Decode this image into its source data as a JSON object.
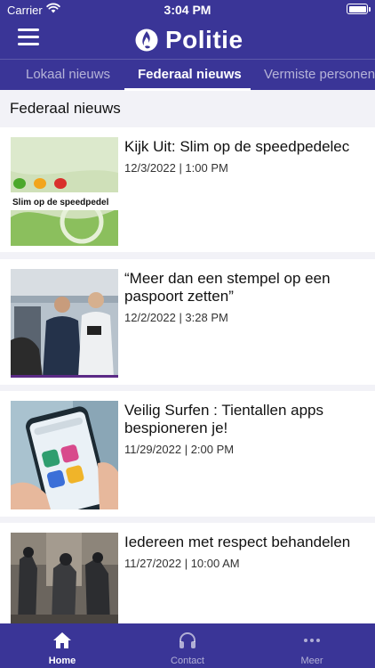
{
  "status_bar": {
    "carrier": "Carrier",
    "time": "3:04 PM"
  },
  "header": {
    "brand": "Politie",
    "menu_icon": "hamburger-menu-icon",
    "logo_icon": "flame-logo-icon"
  },
  "tabs": [
    {
      "label": "Lokaal nieuws",
      "active": false
    },
    {
      "label": "Federaal nieuws",
      "active": true
    },
    {
      "label": "Vermiste personen",
      "active": false
    }
  ],
  "section_title": "Federaal nieuws",
  "articles": [
    {
      "title": "Kijk Uit: Slim op de speedpedelec",
      "date": "12/3/2022 | 1:00 PM",
      "thumb_caption": "Slim op de speedpedel"
    },
    {
      "title": "“Meer dan een stempel op een paspoort zetten”",
      "date": "12/2/2022 | 3:28 PM"
    },
    {
      "title": "Veilig Surfen : Tientallen apps bespioneren je!",
      "date": "11/29/2022 | 2:00 PM"
    },
    {
      "title": "Iedereen met respect behandelen",
      "date": "11/27/2022 | 10:00 AM"
    }
  ],
  "tabbar": [
    {
      "label": "Home",
      "icon": "home-icon",
      "active": true
    },
    {
      "label": "Contact",
      "icon": "headphones-icon",
      "active": false
    },
    {
      "label": "Meer",
      "icon": "more-dots-icon",
      "active": false
    }
  ],
  "colors": {
    "brand": "#3a3597",
    "background": "#f2f2f7",
    "card": "#ffffff"
  }
}
